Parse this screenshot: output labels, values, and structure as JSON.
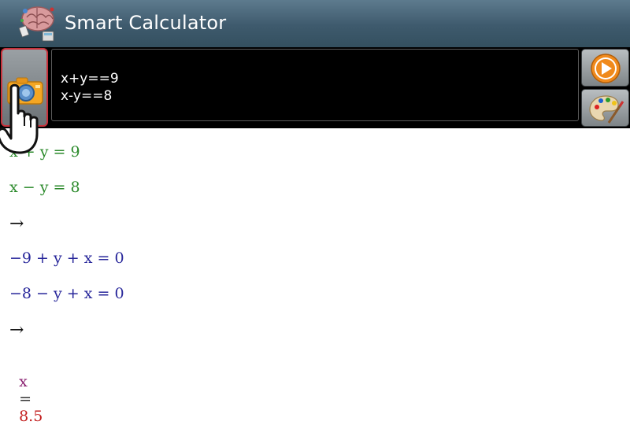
{
  "app": {
    "title": "Smart Calculator",
    "icon": "brain-calculator-icon"
  },
  "input": {
    "lines": [
      "x+y==9",
      "x-y==8"
    ]
  },
  "buttons": {
    "camera": "camera-icon",
    "run": "play-icon",
    "palette": "palette-icon"
  },
  "results": {
    "eq1": "x + y = 9",
    "eq2": "x − y = 8",
    "arrow1": "→",
    "eq3": "−9 + y + x = 0",
    "eq4": "−8 − y + x = 0",
    "arrow2": "→",
    "answer_var": "x",
    "answer_eq": "=",
    "answer_val": "8.5"
  },
  "colors": {
    "actionbar": "#3e5a6d",
    "input_eq": "#2b8a2b",
    "transformed_eq": "#27269a",
    "answer": "#c21c1c",
    "highlight_border": "#c8323c",
    "play": "#f08a1c"
  }
}
